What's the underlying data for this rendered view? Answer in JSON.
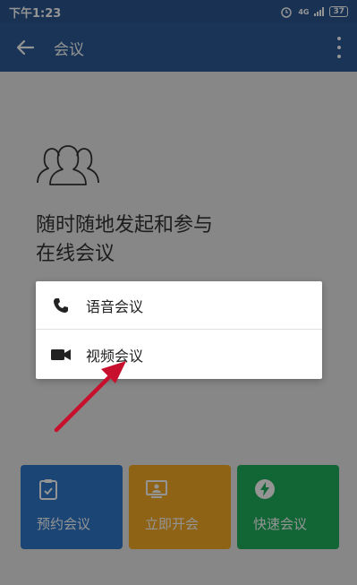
{
  "status": {
    "time": "下午1:23",
    "network": "4G",
    "battery": "37"
  },
  "appbar": {
    "title": "会议",
    "back_icon": "arrow-back",
    "menu_icon": "more-vert"
  },
  "hero": {
    "icon": "people-group",
    "headline_line1": "随时随地发起和参与",
    "headline_line2": "在线会议"
  },
  "tiles": [
    {
      "label": "预约会议",
      "icon": "calendar-clipboard",
      "color": "#2d78c8"
    },
    {
      "label": "立即开会",
      "icon": "monitor-person",
      "color": "#f4ab25"
    },
    {
      "label": "快速会议",
      "icon": "lightning-bolt",
      "color": "#1fae5c"
    }
  ],
  "dialog": {
    "options": [
      {
        "label": "语音会议",
        "icon": "phone"
      },
      {
        "label": "视频会议",
        "icon": "video-camera"
      }
    ]
  },
  "annotation": {
    "arrow_color": "#c8102e"
  }
}
